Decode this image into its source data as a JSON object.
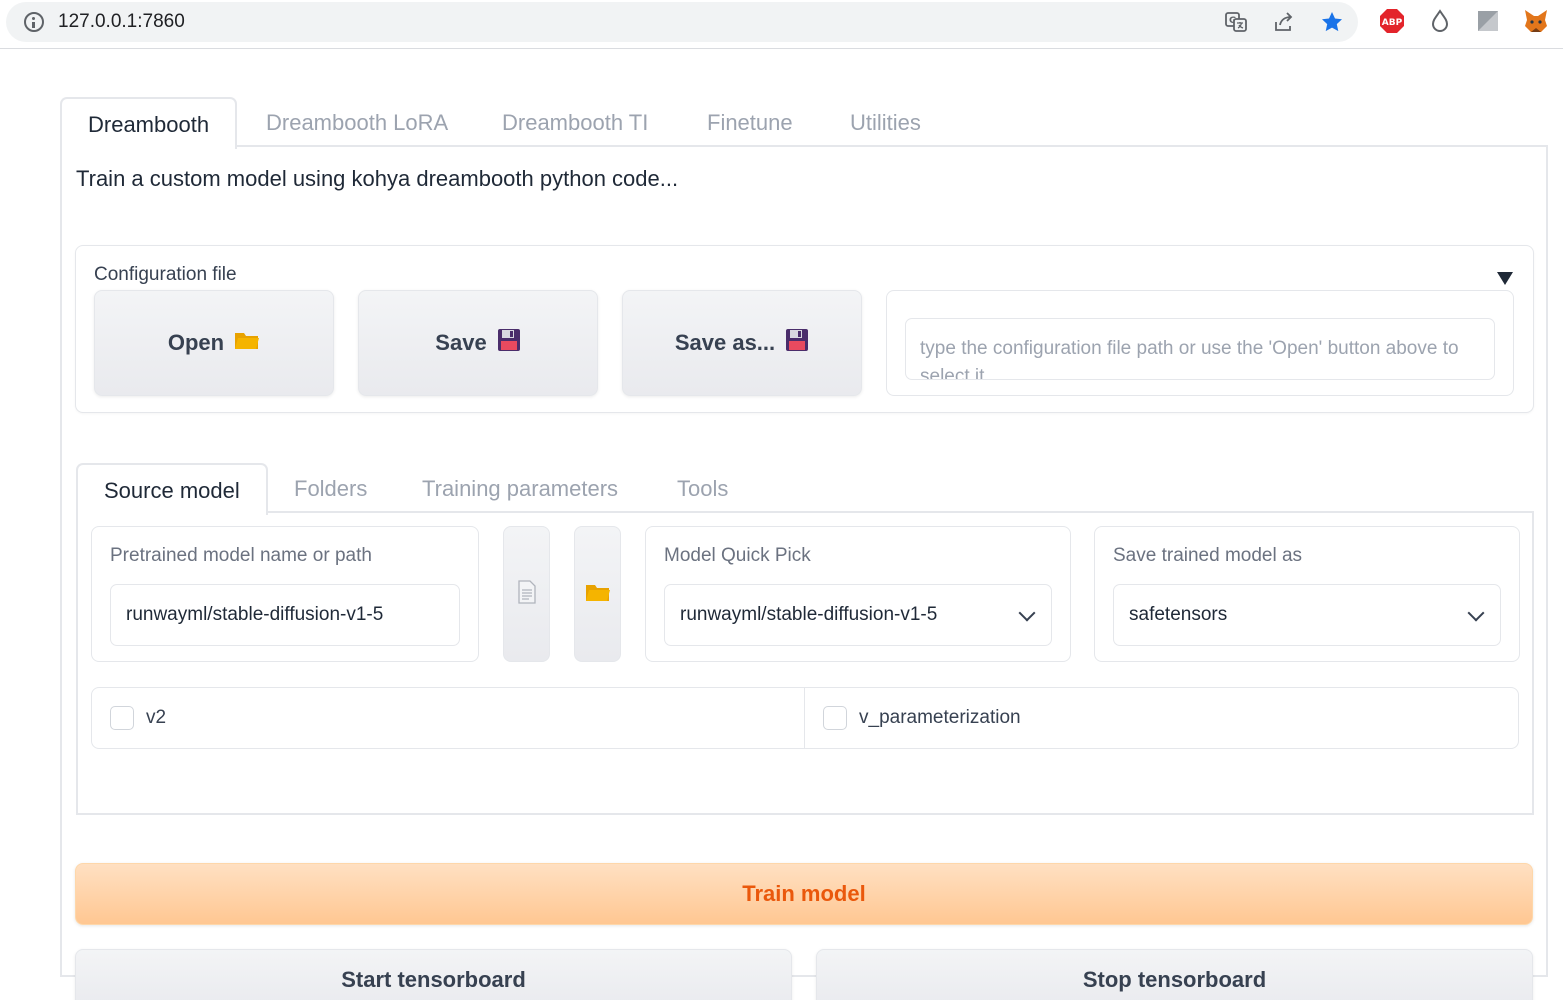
{
  "browser": {
    "url": "127.0.0.1:7860",
    "icons": [
      "translate-icon",
      "share-icon",
      "bookmark-star-icon",
      "adblock-plus-icon",
      "drop-extension-icon",
      "square-extension-icon",
      "metamask-fox-icon"
    ],
    "adblock_label": "ABP",
    "colors": {
      "star": "#1a73e8",
      "adblock": "#e3242b",
      "fox": "#e2761b"
    }
  },
  "top_tabs": [
    {
      "label": "Dreambooth",
      "active": true
    },
    {
      "label": "Dreambooth LoRA",
      "active": false
    },
    {
      "label": "Dreambooth TI",
      "active": false
    },
    {
      "label": "Finetune",
      "active": false
    },
    {
      "label": "Utilities",
      "active": false
    }
  ],
  "description": "Train a custom model using kohya dreambooth python code...",
  "config": {
    "label": "Configuration file",
    "open_label": "Open",
    "save_label": "Save",
    "save_as_label": "Save as...",
    "path_placeholder": "type the configuration file path or use the 'Open' button above to select it..."
  },
  "sub_tabs": [
    {
      "label": "Source model",
      "active": true
    },
    {
      "label": "Folders",
      "active": false
    },
    {
      "label": "Training parameters",
      "active": false
    },
    {
      "label": "Tools",
      "active": false
    }
  ],
  "source_model": {
    "pretrained_label": "Pretrained model name or path",
    "pretrained_value": "runwayml/stable-diffusion-v1-5",
    "quick_pick_label": "Model Quick Pick",
    "quick_pick_value": "runwayml/stable-diffusion-v1-5",
    "save_as_label": "Save trained model as",
    "save_as_value": "safetensors",
    "v2_label": "v2",
    "v_param_label": "v_parameterization"
  },
  "actions": {
    "train_label": "Train model",
    "start_tb_label": "Start tensorboard",
    "stop_tb_label": "Stop tensorboard"
  },
  "colors": {
    "train_text": "#ea580c",
    "train_bg": "#ffd3aa",
    "folder_icon": "#f5b400",
    "floppy_icon": "#4a2d6b"
  }
}
